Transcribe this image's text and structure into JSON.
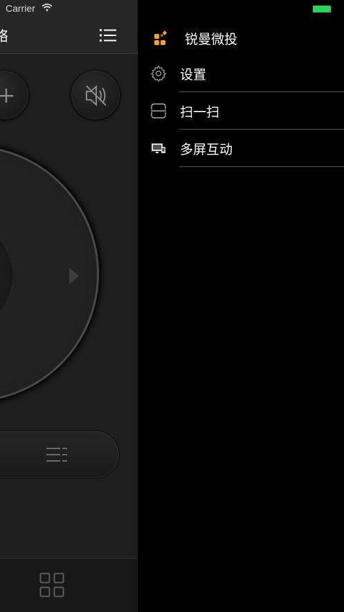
{
  "status_bar": {
    "carrier": "Carrier"
  },
  "remote": {
    "nav_title": "络",
    "menu_button_icon": "list-icon",
    "volume_up_icon": "plus-icon",
    "mute_icon": "speaker-muted-icon",
    "dpad_right_icon": "triangle-right-icon",
    "menu_pill_icon": "menu-lines-icon",
    "tab_icon": "grid-icon"
  },
  "side_menu": {
    "app_name": "锐曼微投",
    "items": [
      {
        "label": "设置",
        "icon": "gear-icon"
      },
      {
        "label": "扫一扫",
        "icon": "scan-icon"
      },
      {
        "label": "多屏互动",
        "icon": "screen-cast-icon"
      }
    ]
  },
  "colors": {
    "accent": "#f5a623",
    "battery": "#2fd158",
    "divider": "#555555"
  }
}
